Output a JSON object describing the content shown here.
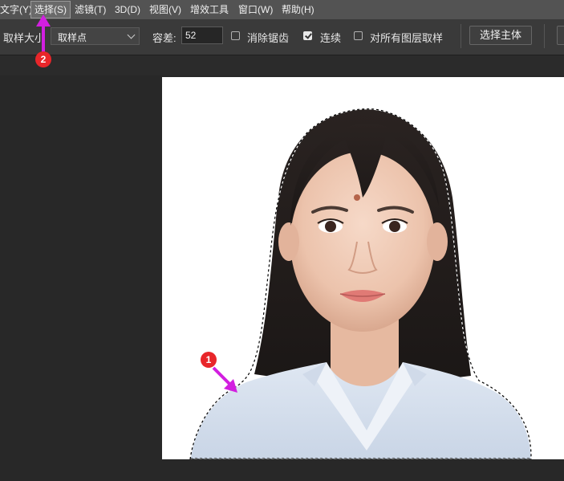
{
  "menu": {
    "items": [
      {
        "label": "文字(Y)"
      },
      {
        "label": "选择(S)"
      },
      {
        "label": "滤镜(T)"
      },
      {
        "label": "3D(D)"
      },
      {
        "label": "视图(V)"
      },
      {
        "label": "增效工具"
      },
      {
        "label": "窗口(W)"
      },
      {
        "label": "帮助(H)"
      }
    ]
  },
  "options": {
    "sample_size_label": "取样大小",
    "sample_size_value": "取样点",
    "tolerance_label": "容差:",
    "tolerance_value": "52",
    "anti_alias_label": "消除锯齿",
    "anti_alias_checked": false,
    "contiguous_label": "连续",
    "contiguous_checked": true,
    "sample_all_layers_label": "对所有图层取样",
    "sample_all_layers_checked": false,
    "select_subject_label": "选择主体"
  },
  "annotations": {
    "marker_1": "1",
    "marker_2": "2",
    "arrow_color": "#d21fe0",
    "marker_color": "#e8262a"
  },
  "colors": {
    "menubar": "#535353",
    "optionsbar": "#3a3a3a",
    "workspace": "#282828",
    "document": "#ffffff"
  }
}
